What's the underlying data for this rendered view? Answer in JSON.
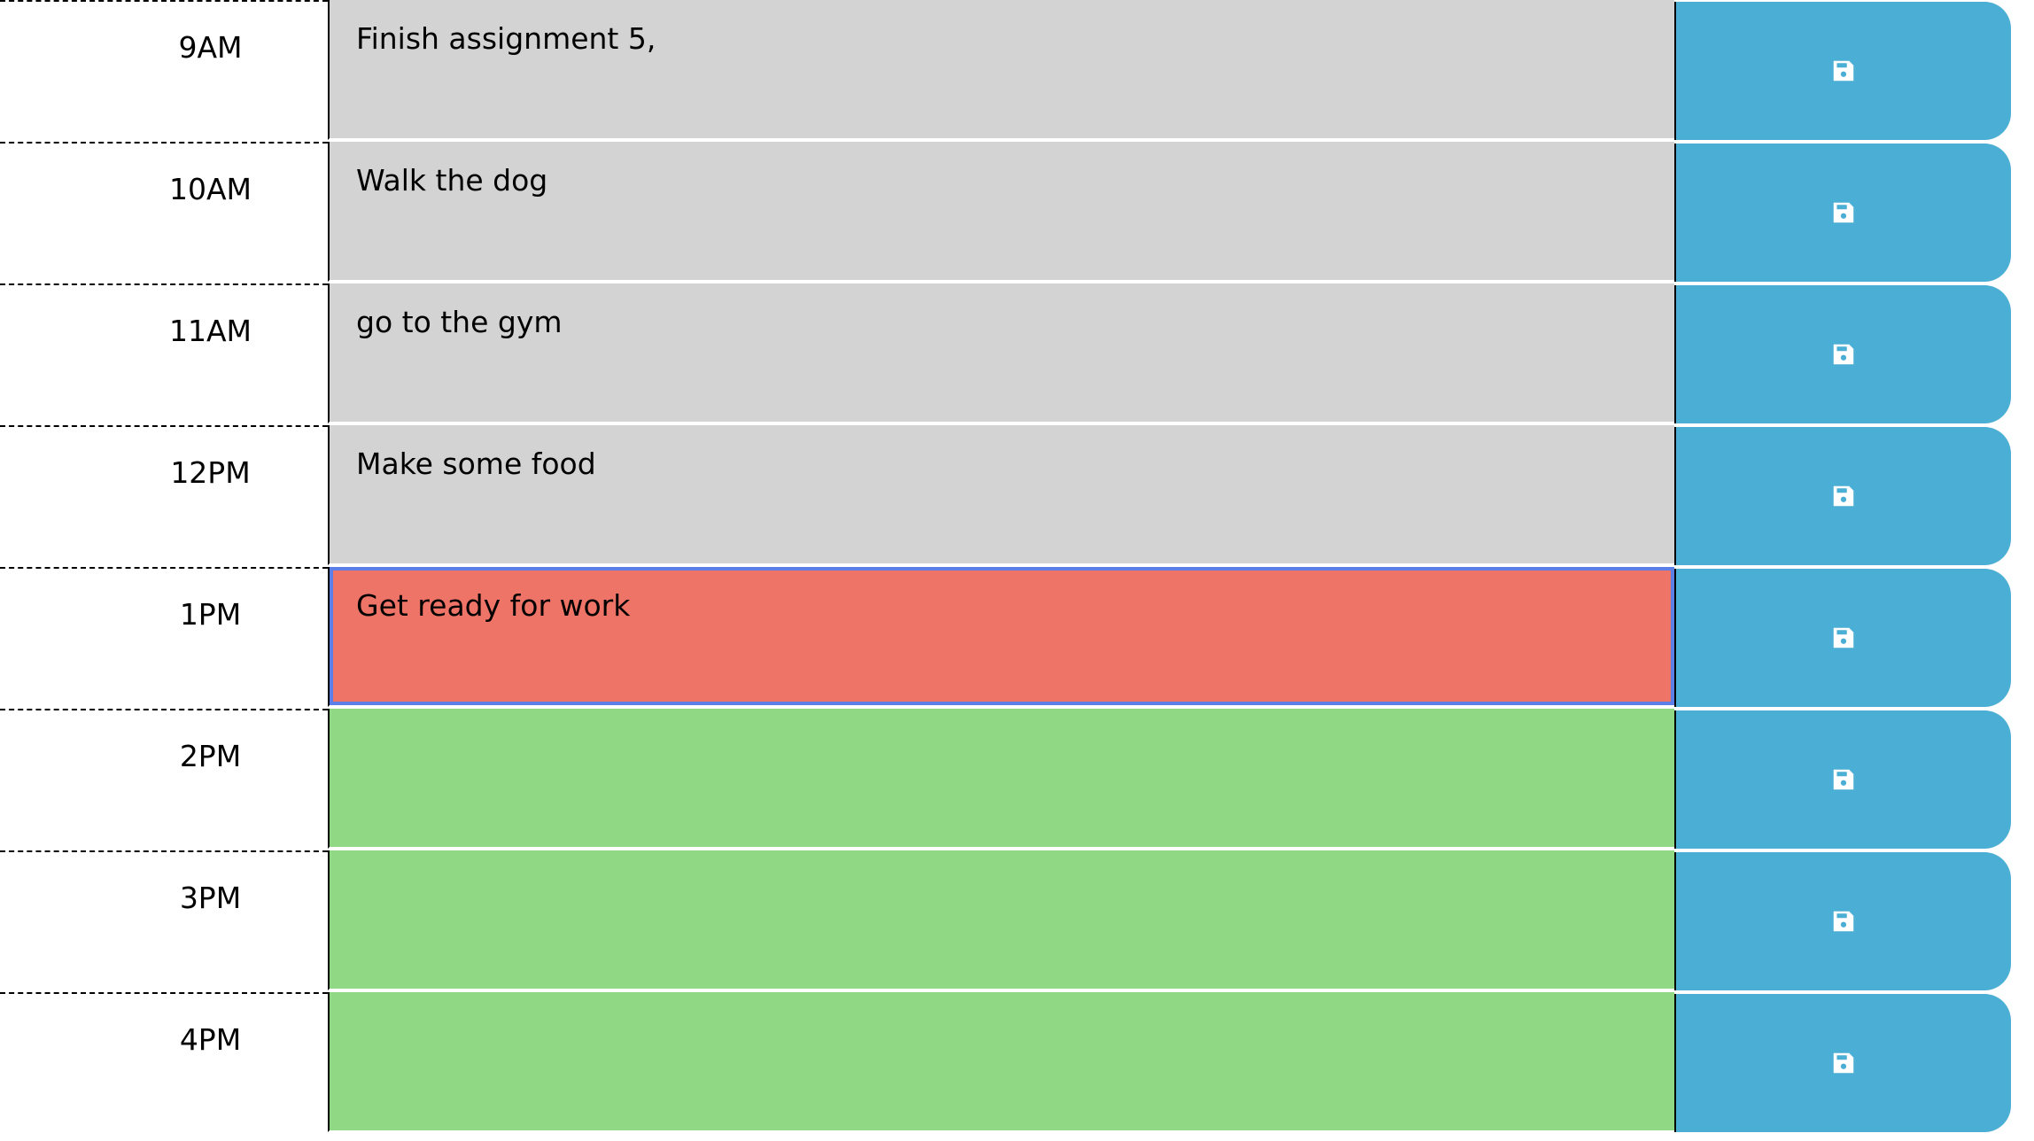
{
  "planner": {
    "colors": {
      "past": "#d3d3d3",
      "present": "#ef7468",
      "future": "#91d884",
      "save_button": "#4aaed5"
    },
    "save_icon": "floppy-disk-icon",
    "rows": [
      {
        "hour": "9AM",
        "text": "Finish assignment 5,",
        "state": "past"
      },
      {
        "hour": "10AM",
        "text": "Walk the dog",
        "state": "past"
      },
      {
        "hour": "11AM",
        "text": "go to the gym",
        "state": "past"
      },
      {
        "hour": "12PM",
        "text": "Make some food",
        "state": "past"
      },
      {
        "hour": "1PM",
        "text": "Get ready for work",
        "state": "present",
        "focused": true
      },
      {
        "hour": "2PM",
        "text": "",
        "state": "future"
      },
      {
        "hour": "3PM",
        "text": "",
        "state": "future"
      },
      {
        "hour": "4PM",
        "text": "",
        "state": "future"
      }
    ]
  }
}
